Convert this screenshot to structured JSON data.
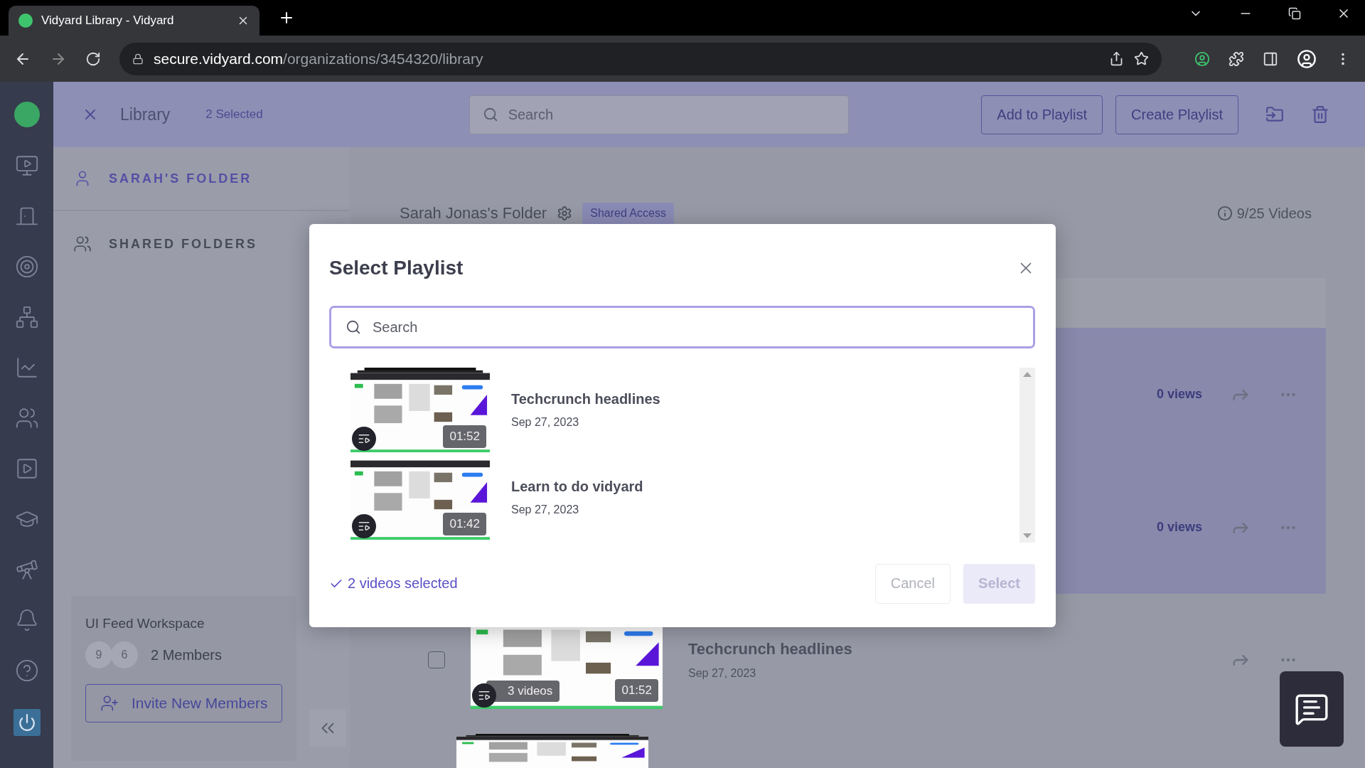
{
  "browser": {
    "tab_title": "Vidyard Library - Vidyard",
    "url_host": "secure.vidyard.com",
    "url_path": "/organizations/3454320/library"
  },
  "header": {
    "title": "Library",
    "selected_count": "2 Selected",
    "search_placeholder": "Search",
    "buttons": [
      "Add to Playlist",
      "Create Playlist"
    ]
  },
  "folders": [
    {
      "label": "SARAH'S FOLDER",
      "selected": true
    },
    {
      "label": "SHARED FOLDERS",
      "selected": false
    }
  ],
  "workspace": {
    "name": "UI Feed Workspace",
    "avatars": [
      "9",
      "6"
    ],
    "members": "2 Members",
    "invite_button": "Invite New Members"
  },
  "main": {
    "folder_title": "Sarah Jonas's Folder",
    "access_badge": "Shared Access",
    "video_count": "9/25 Videos"
  },
  "rows": [
    {
      "selected": true,
      "views": "0 views"
    },
    {
      "selected": true,
      "views": "0 views"
    },
    {
      "selected": false,
      "title": "Techcrunch headlines",
      "date": "Sep 27, 2023",
      "video_count": "3 videos",
      "duration": "01:52"
    },
    {
      "selected": false
    }
  ],
  "modal": {
    "title": "Select Playlist",
    "search_placeholder": "Search",
    "playlists": [
      {
        "title": "Techcrunch headlines",
        "date": "Sep 27, 2023",
        "duration": "01:52"
      },
      {
        "title": "Learn to do vidyard",
        "date": "Sep 27, 2023",
        "duration": "01:42"
      }
    ],
    "selection_note": "2 videos selected",
    "cancel": "Cancel",
    "select": {
      "label": "Select",
      "disabled": true
    }
  }
}
